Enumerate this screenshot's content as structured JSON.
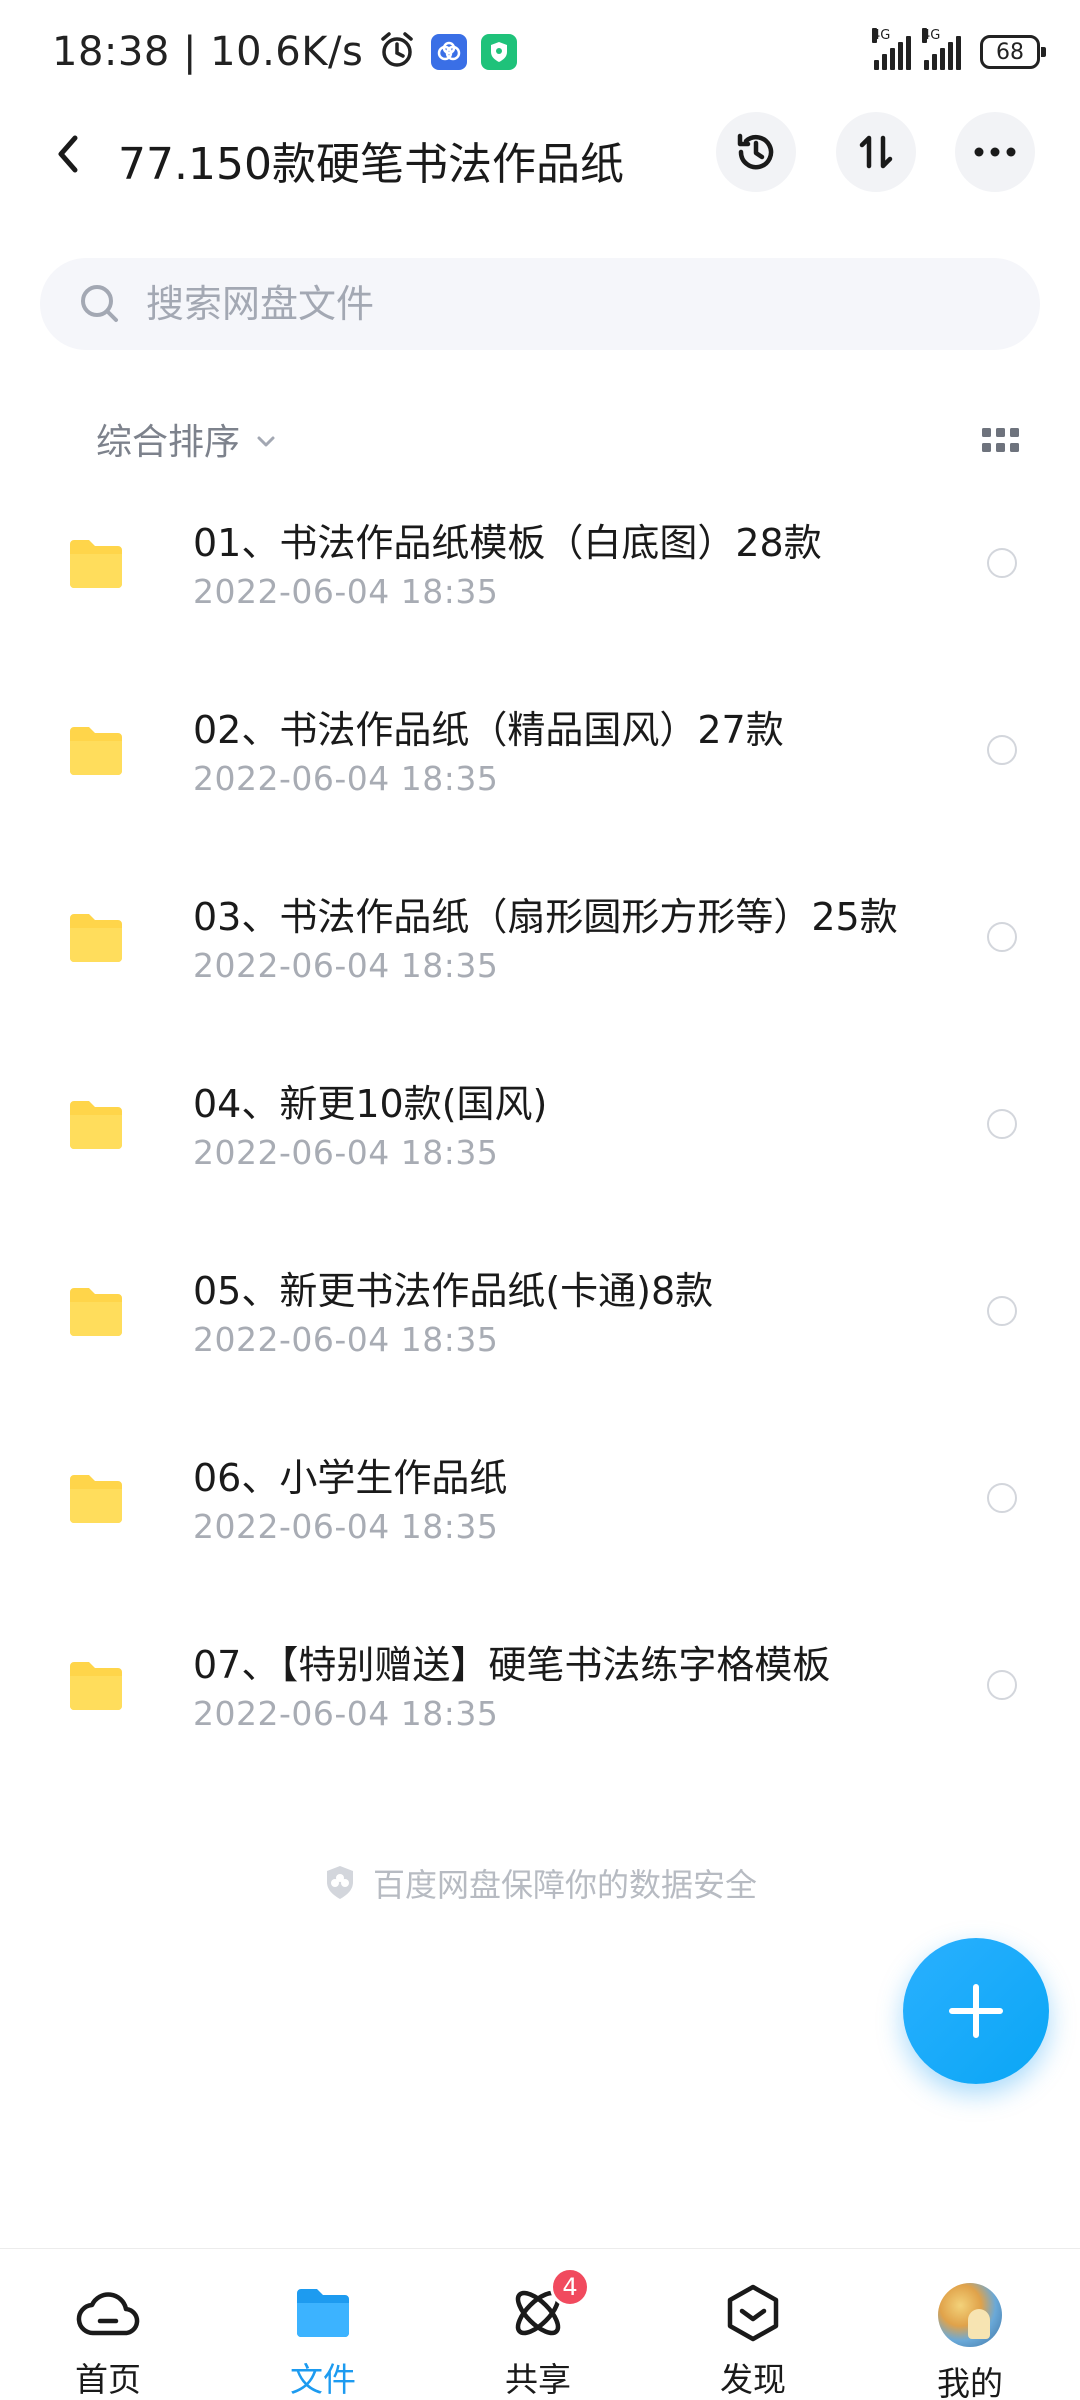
{
  "status_bar": {
    "time": "18:38 | 10.6K/s",
    "net_1": "4G",
    "net_2": "4G",
    "battery": "68"
  },
  "header": {
    "title": "77.150款硬笔书法作品纸",
    "icons": [
      "history-icon",
      "sort-transfer-icon",
      "more-icon"
    ]
  },
  "search": {
    "placeholder": "搜索网盘文件"
  },
  "sort": {
    "label": "综合排序"
  },
  "files": [
    {
      "name": "01、书法作品纸模板（白底图）28款",
      "date": "2022-06-04  18:35"
    },
    {
      "name": "02、书法作品纸（精品国风）27款",
      "date": "2022-06-04  18:35"
    },
    {
      "name": "03、书法作品纸（扇形圆形方形等）25款",
      "date": "2022-06-04  18:35"
    },
    {
      "name": "04、新更10款(国风)",
      "date": "2022-06-04  18:35"
    },
    {
      "name": "05、新更书法作品纸(卡通)8款",
      "date": "2022-06-04  18:35"
    },
    {
      "name": "06、小学生作品纸",
      "date": "2022-06-04  18:35"
    },
    {
      "name": "07、【特别赠送】硬笔书法练字格模板",
      "date": "2022-06-04  18:35"
    }
  ],
  "footer_note": "百度网盘保障你的数据安全",
  "colors": {
    "accent": "#1d9bf0",
    "folder": "#ffd54a",
    "badge": "#f14a5e"
  },
  "bottom_nav": {
    "home": "首页",
    "files": "文件",
    "share": "共享",
    "share_badge": "4",
    "discover": "发现",
    "me": "我的",
    "active": "files"
  }
}
